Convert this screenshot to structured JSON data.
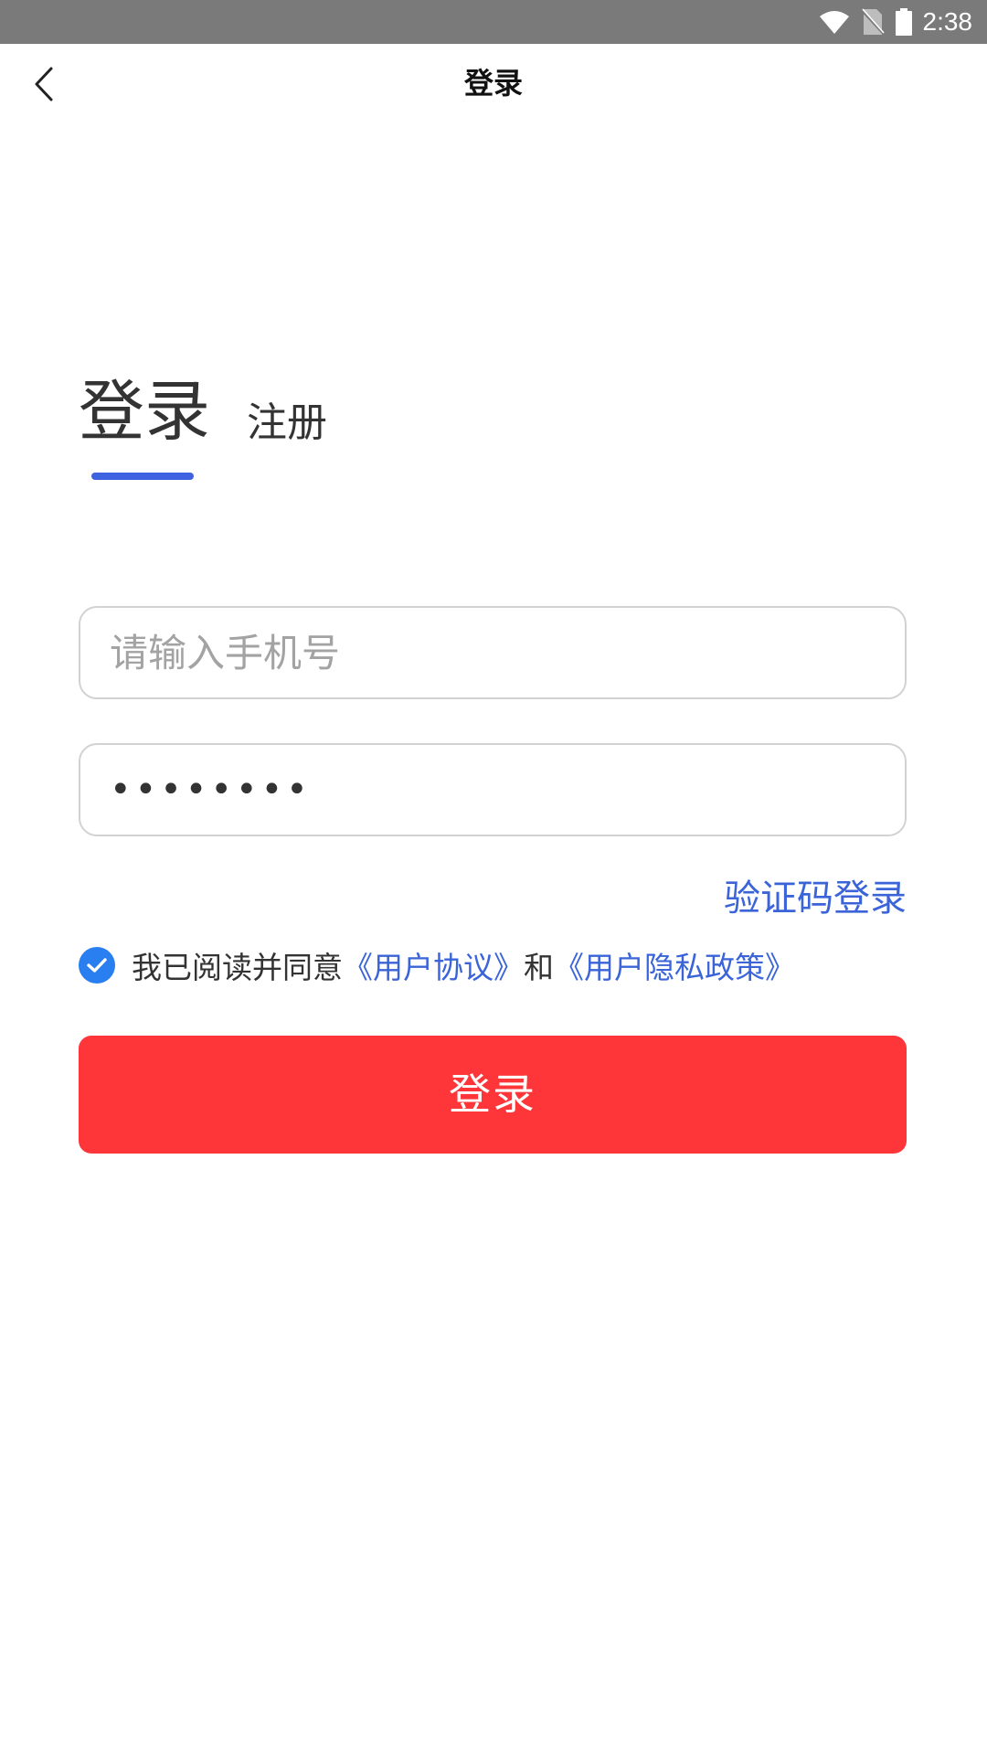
{
  "status_bar": {
    "time": "2:38",
    "icons": [
      "wifi-icon",
      "no-sim-icon",
      "battery-icon"
    ],
    "bg_color": "#7a7a7a"
  },
  "app_bar": {
    "title": "登录",
    "back_icon": "chevron-left-icon"
  },
  "tabs": {
    "login_label": "登录",
    "register_label": "注册",
    "active": "login",
    "indicator_color": "#3f63e0"
  },
  "form": {
    "phone_placeholder": "请输入手机号",
    "phone_value": "",
    "password_value": "••••••••"
  },
  "links": {
    "code_login": "验证码登录"
  },
  "agreement": {
    "checked": true,
    "prefix": "我已阅读并同意",
    "user_agreement": "《用户协议》",
    "and": "和",
    "privacy_policy": "《用户隐私政策》"
  },
  "login_button": {
    "label": "登录",
    "color": "#fe3639"
  }
}
